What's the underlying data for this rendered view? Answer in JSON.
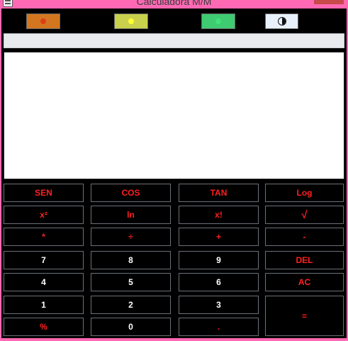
{
  "window": {
    "title": "Calculadora M/M"
  },
  "themes": [
    {
      "id": "orange",
      "bg": "#d2771f",
      "dot": "#e03c19"
    },
    {
      "id": "yellow",
      "bg": "#c8d04c",
      "dot": "#ffff33"
    },
    {
      "id": "green",
      "bg": "#3ecb71",
      "dot": "#45e07a"
    }
  ],
  "contrast": {
    "bg": "#e8f0fb"
  },
  "expression": {
    "value": ""
  },
  "display": {
    "value": ""
  },
  "keys": {
    "sen": "SEN",
    "cos": "COS",
    "tan": "TAN",
    "log": "Log",
    "square": "x²",
    "ln": "ln",
    "factorial": "x!",
    "sqrt": "√",
    "multiply": "*",
    "divide": "÷",
    "plus": "+",
    "minus": "-",
    "seven": "7",
    "eight": "8",
    "nine": "9",
    "del": "DEL",
    "four": "4",
    "five": "5",
    "six": "6",
    "ac": "AC",
    "one": "1",
    "two": "2",
    "three": "3",
    "equals": "=",
    "percent": "%",
    "zero": "0",
    "dot": "."
  }
}
